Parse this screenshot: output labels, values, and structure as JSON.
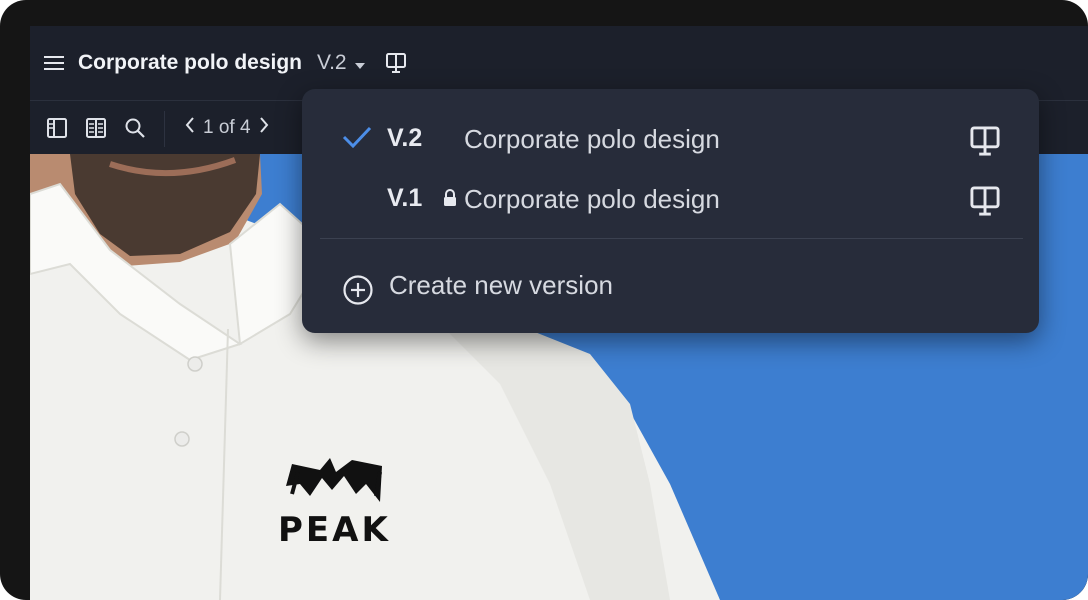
{
  "header": {
    "menu_icon": "hamburger-icon",
    "title": "Corporate polo design",
    "version_label": "V.2",
    "version_caret_icon": "caret-down-icon",
    "present_icon": "presentation-icon"
  },
  "toolbar": {
    "icons": [
      "sidebar-panel-icon",
      "pages-grid-icon",
      "search-icon"
    ],
    "pager": {
      "prev_icon": "chevron-left-icon",
      "text": "1 of 4",
      "next_icon": "chevron-right-icon"
    }
  },
  "version_menu": {
    "items": [
      {
        "version": "V.2",
        "name": "Corporate polo design",
        "selected": true,
        "locked": false,
        "icon": "presentation-icon"
      },
      {
        "version": "V.1",
        "name": "Corporate polo design",
        "selected": false,
        "locked": true,
        "icon": "presentation-icon"
      }
    ],
    "create_label": "Create new version",
    "create_icon": "plus-circle-icon",
    "check_icon": "checkmark-icon",
    "lock_icon": "lock-icon"
  },
  "canvas": {
    "logo_text": "PEAK",
    "background_color": "#3d7ed0"
  },
  "colors": {
    "app_bg": "#1d212c",
    "menu_bg": "#272c3a",
    "accent": "#3d7ed0",
    "check": "#4c8ee8"
  }
}
